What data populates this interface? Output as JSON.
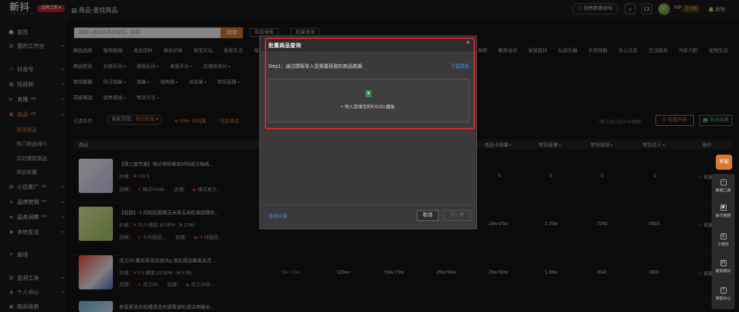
{
  "topbar": {
    "logo": "新抖",
    "logo_sub": "XINDOUBIG.CN",
    "brand_pill": "品牌工具 ▾",
    "breadcrumb": "商品-查找商品",
    "help_label": "ⓘ 销售数据说明",
    "vip_label": "VIP",
    "vip_badge": "企业版",
    "notify_label": "🔔 新物"
  },
  "sidebar": {
    "items": [
      {
        "label": "首页",
        "icon": "🏠"
      },
      {
        "label": "我的工作台",
        "icon": "▤"
      },
      {
        "label": "抖音号",
        "icon": "⚇"
      },
      {
        "label": "短视频",
        "icon": "▦"
      },
      {
        "label": "直播",
        "icon": "▶",
        "vip": "VIP"
      },
      {
        "label": "商品",
        "icon": "▣",
        "vip": "VIP"
      },
      {
        "label": "小店推广",
        "icon": "▤",
        "vip": "VIP"
      },
      {
        "label": "品牌营销",
        "icon": "♦",
        "vip": "VIP"
      },
      {
        "label": "品类洞察",
        "icon": "◈",
        "vip": "VIP"
      },
      {
        "label": "本地生活",
        "icon": "◉"
      },
      {
        "label": "商场",
        "icon": "♥"
      },
      {
        "label": "监测工具",
        "icon": "▤"
      },
      {
        "label": "个人中心",
        "icon": "♟"
      },
      {
        "label": "购买续费",
        "icon": "▣"
      }
    ],
    "sub_items": [
      "查找商品",
      "热门商品排行",
      "实时爆款商品",
      "商品收藏"
    ]
  },
  "search": {
    "placeholder": "请输入商品名称关键词、链接",
    "button": "搜索",
    "advanced": "高级搜索",
    "batch": "批量查询"
  },
  "filters": {
    "category_label": "商品品类",
    "categories": [
      "服饰鞋帽",
      "食品饮料",
      "美妆护肤",
      "珠宝文玩",
      "家居生活",
      "母婴"
    ],
    "categories_right": [
      "保健",
      "教育培训",
      "家居建材",
      "玩具乐器",
      "农资绿植",
      "办公文具",
      "生活服务",
      "汽车汽配",
      "宠物生活"
    ],
    "info_label": "商品信息",
    "info": [
      "价格区间",
      "佣金区间",
      "来源平台",
      "店铺体验分"
    ],
    "sales_label": "带货数据",
    "sales": [
      "昨日销量",
      "销量",
      "销售额",
      "浏览量",
      "带货直播"
    ],
    "advanced_label": "高级筛选",
    "advanced": [
      "销售渠道",
      "带货方式"
    ]
  },
  "selected": {
    "label": "已选条件",
    "scope_prefix": "搜索范围：",
    "scope_value": "商品标题",
    "count": "⇆ 999+ 条结果",
    "fav": "♡ 设定筛选",
    "hint": "*默认展示近30天数据",
    "config_button": "⚙ 配置列表",
    "export_button": "导出结果"
  },
  "table": {
    "headers": {
      "product": "商品",
      "sales_sort": "商品卡销量",
      "live": "带货直播",
      "video": "带货视频",
      "kol": "带货达人",
      "action": "操作"
    },
    "rows": [
      {
        "title": "【限三度专属】维达棉韧柔软M码纸巾抽纸...",
        "price_label": "价格：",
        "price": "¥ 239.9",
        "commission": "",
        "brand_label": "品牌：",
        "brand": "维达Vinda",
        "shop_label": "店铺：",
        "shop": "维达官方...",
        "c1": "",
        "c2": "",
        "c3": "",
        "c4": "",
        "card": "0",
        "live": "2",
        "video": "0",
        "kol": "1",
        "collect": "☆ 收藏"
      },
      {
        "title": "【轻甜】十月稻田黄糯玉米棒玉米粒香甜糯东...",
        "price_label": "价格：",
        "price": "¥ 29.9",
        "commission": "佣金:10.00%（¥ 2.99）",
        "brand_label": "品牌：",
        "brand": "十月稻田...",
        "shop_label": "店铺：",
        "shop": "十月稻田...",
        "c1": "",
        "c2": "",
        "c3": "",
        "c4": "",
        "card": "10w-25w",
        "live": "1.25w",
        "video": "7240",
        "kol": "5893",
        "collect": "☆ 收藏"
      },
      {
        "title": "活力28 薰衣草洗衣液2kg 洗化用品薰香去渍...",
        "price_label": "价格：",
        "price": "¥ 9.9",
        "commission": "佣金:10.00%（¥ 0.99）",
        "brand_label": "品牌：",
        "brand": "活力28",
        "shop_label": "店铺：",
        "shop": "活力28衣...",
        "c1": "5w-7.5w",
        "c2": "100w+",
        "c3": "50w-75w",
        "c4": "25w-50w",
        "card": "25w-50w",
        "live": "1.36w",
        "video": "3541",
        "kol": "3901",
        "collect": "☆ 收藏"
      },
      {
        "title": "老管家洗衣机槽清洗剂滚筒波轮清洁神器全..."
      }
    ]
  },
  "modal": {
    "title": "批量商品查询",
    "close": "×",
    "step": "Step1：通过模板导入您需要获取的商品数据",
    "download": "下载模板",
    "excel_icon": "X",
    "upload_text": "+ 导入您填写的EXCEL模板",
    "log": "查询记录",
    "cancel": "取消",
    "next": "下一步"
  },
  "tools": {
    "mascot": "客服",
    "items": [
      {
        "label": "数据工具",
        "icon": "~"
      },
      {
        "label": "新手教程",
        "icon": "▣"
      },
      {
        "label": "小程序",
        "icon": "◎"
      },
      {
        "label": "联系顾问",
        "icon": "☊"
      },
      {
        "label": "帮助中心",
        "icon": "?"
      }
    ]
  }
}
